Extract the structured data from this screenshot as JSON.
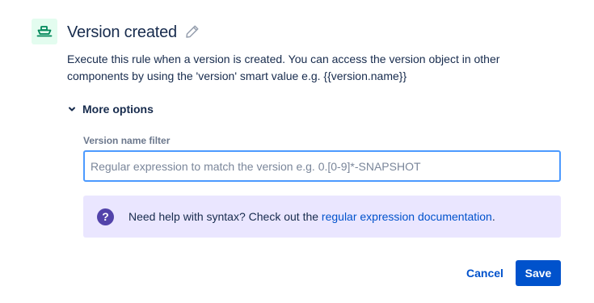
{
  "trigger": {
    "icon": "ship-icon",
    "icon_color": "#00875a",
    "icon_bg": "#e3fcef",
    "title": "Version created",
    "edit_icon": "pencil-icon",
    "description": "Execute this rule when a version is created. You can access the version object in other components by using the 'version' smart value e.g. {{version.name}}"
  },
  "more_options": {
    "label": "More options",
    "icon": "chevron-down-icon",
    "expanded": true
  },
  "version_filter": {
    "label": "Version name filter",
    "value": "",
    "placeholder": "Regular expression to match the version e.g. 0.[0-9]*-SNAPSHOT"
  },
  "help": {
    "icon": "question-circle-icon",
    "text_before": "Need help with syntax? Check out the",
    "link_text": "regular expression documentation",
    "text_after": ".",
    "bg_color": "#eae6ff"
  },
  "actions": {
    "cancel_label": "Cancel",
    "save_label": "Save",
    "primary_color": "#0052cc"
  }
}
